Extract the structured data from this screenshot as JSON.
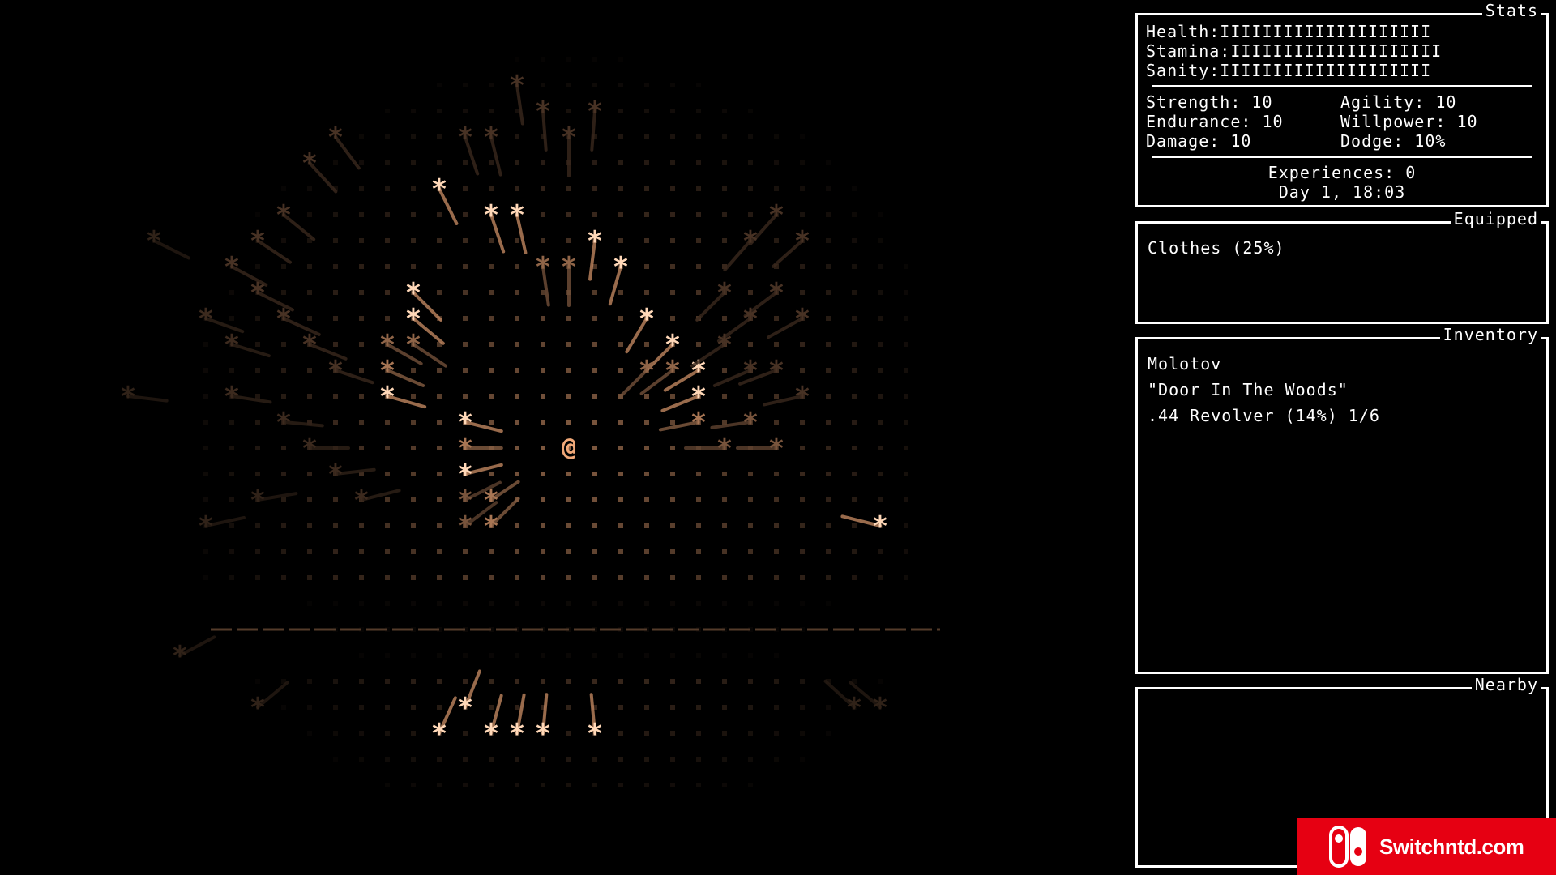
{
  "stats": {
    "title": "Stats",
    "health_label": "Health:",
    "health_bar": "IIIIIIIIIIIIIIIIIIII",
    "stamina_label": "Stamina:",
    "stamina_bar": "IIIIIIIIIIIIIIIIIIII",
    "sanity_label": "Sanity:",
    "sanity_bar": "IIIIIIIIIIIIIIIIIIII",
    "strength": "Strength: 10",
    "agility": "Agility: 10",
    "endurance": "Endurance: 10",
    "willpower": "Willpower: 10",
    "damage": "Damage: 10",
    "dodge": "Dodge: 10%",
    "experiences": "Experiences: 0",
    "day_time": "Day 1, 18:03"
  },
  "equipped": {
    "title": "Equipped",
    "items": [
      "Clothes (25%)"
    ]
  },
  "inventory": {
    "title": "Inventory",
    "items": [
      "Molotov",
      "\"Door In The Woods\"",
      ".44 Revolver (14%) 1/6"
    ]
  },
  "nearby": {
    "title": "Nearby",
    "items": []
  },
  "world": {
    "player_glyph": "@",
    "tree_glyph": "*",
    "floor_glyph": ".",
    "light_color": "#f0a878",
    "bright_color": "#ffd8b8"
  },
  "watermark": {
    "text": "Switchntd.com",
    "color": "#e60012"
  }
}
